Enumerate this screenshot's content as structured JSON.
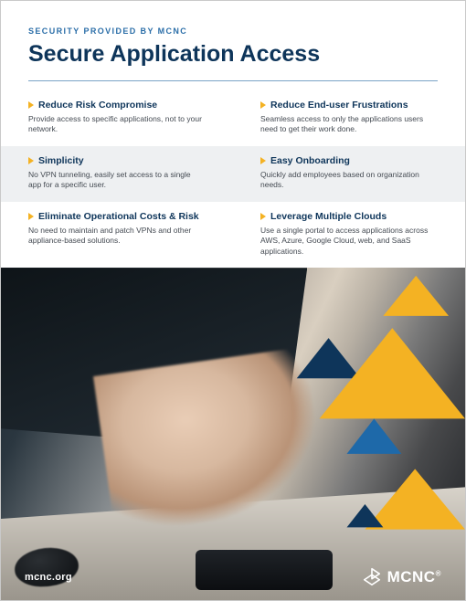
{
  "header": {
    "eyebrow": "SECURITY PROVIDED BY MCNC",
    "title": "Secure Application Access"
  },
  "features": [
    {
      "title": "Reduce Risk Compromise",
      "body": "Provide access to specific applications, not to your network."
    },
    {
      "title": "Reduce End-user Frustrations",
      "body": "Seamless access to only the applications users need to get their work done."
    },
    {
      "title": "Simplicity",
      "body": "No VPN tunneling, easily set access to a single app for a specific user."
    },
    {
      "title": "Easy Onboarding",
      "body": "Quickly add employees based on organization needs."
    },
    {
      "title": "Eliminate Operational Costs & Risk",
      "body": "No need to maintain and patch VPNs and other appliance-based solutions."
    },
    {
      "title": "Leverage Multiple Clouds",
      "body": "Use a single portal to access applications across AWS, Azure, Google Cloud, web, and SaaS applications."
    }
  ],
  "footer": {
    "url": "mcnc.org",
    "brand": "MCNC",
    "registered": "®"
  },
  "colors": {
    "navy": "#0e355a",
    "gold": "#f4b223",
    "blue_accent": "#2b6ea8"
  }
}
